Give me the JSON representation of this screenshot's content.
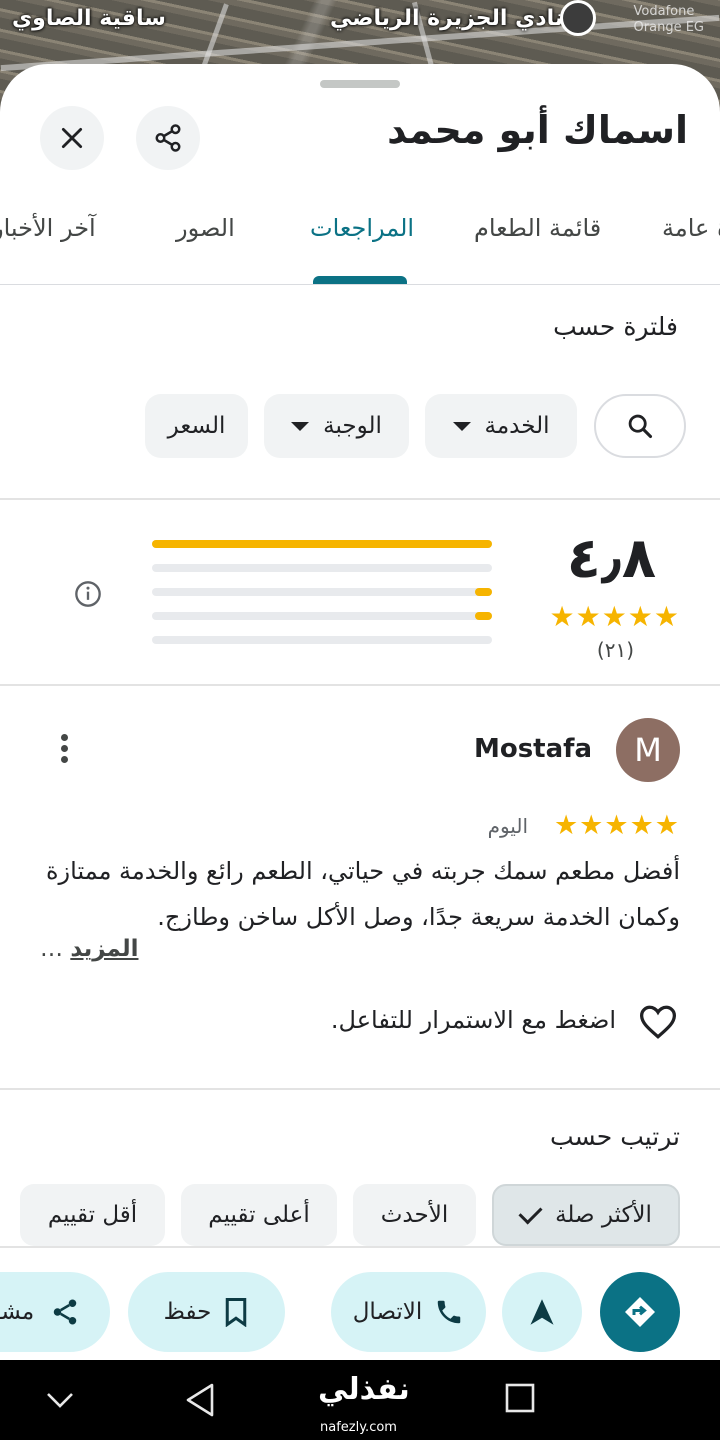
{
  "map": {
    "labels": [
      "نادي الجزيرة الرياضي",
      "ساقية الصاوي"
    ],
    "attribution": [
      "Vodafone",
      "Orange EG"
    ]
  },
  "place": {
    "title": "اسماك أبو محمد",
    "close_icon": "close-icon",
    "share_icon": "share-icon"
  },
  "tabs": [
    {
      "label": "نظرة عامة"
    },
    {
      "label": "قائمة الطعام"
    },
    {
      "label": "المراجعات",
      "active": true
    },
    {
      "label": "الصور"
    },
    {
      "label": "آخر الأخبار"
    }
  ],
  "filter": {
    "title": "فلترة حسب",
    "chips": [
      {
        "label": "الخدمة"
      },
      {
        "label": "الوجبة"
      },
      {
        "label": "السعر"
      }
    ]
  },
  "summary": {
    "rating": "٤٫٨",
    "stars": "★★★★★",
    "count": "(٢١)",
    "distribution": [
      {
        "stars": 5,
        "fraction": 1.0
      },
      {
        "stars": 4,
        "fraction": 0.0
      },
      {
        "stars": 3,
        "fraction": 0.05
      },
      {
        "stars": 2,
        "fraction": 0.05
      },
      {
        "stars": 1,
        "fraction": 0.0
      }
    ]
  },
  "review": {
    "avatar_letter": "M",
    "avatar_color": "#8d6e63",
    "author": "Mostafa",
    "stars": "★★★★★",
    "date": "اليوم",
    "text": "أفضل مطعم سمك جربته في حياتي، الطعم رائع والخدمة ممتازة وكمان الخدمة سريعة جدًا، وصل الأكل ساخن وطازج.",
    "more_label": "المزيد",
    "more_suffix": "…",
    "like_prompt": "اضغط مع الاستمرار للتفاعل."
  },
  "sort": {
    "title": "ترتيب حسب",
    "options": [
      {
        "label": "الأكثر صلة",
        "selected": true
      },
      {
        "label": "الأحدث"
      },
      {
        "label": "أعلى تقييم"
      },
      {
        "label": "أقل تقييم"
      }
    ]
  },
  "actions": {
    "call": "الاتصال",
    "save": "حفظ",
    "share": "مشاركة"
  },
  "watermark": {
    "text": "نفذلي",
    "sub": "nafezly.com"
  },
  "colors": {
    "accent": "#0b7285",
    "star": "#f6b400",
    "chip_bg": "#f1f3f4",
    "action_bg": "#d6f3f6"
  }
}
